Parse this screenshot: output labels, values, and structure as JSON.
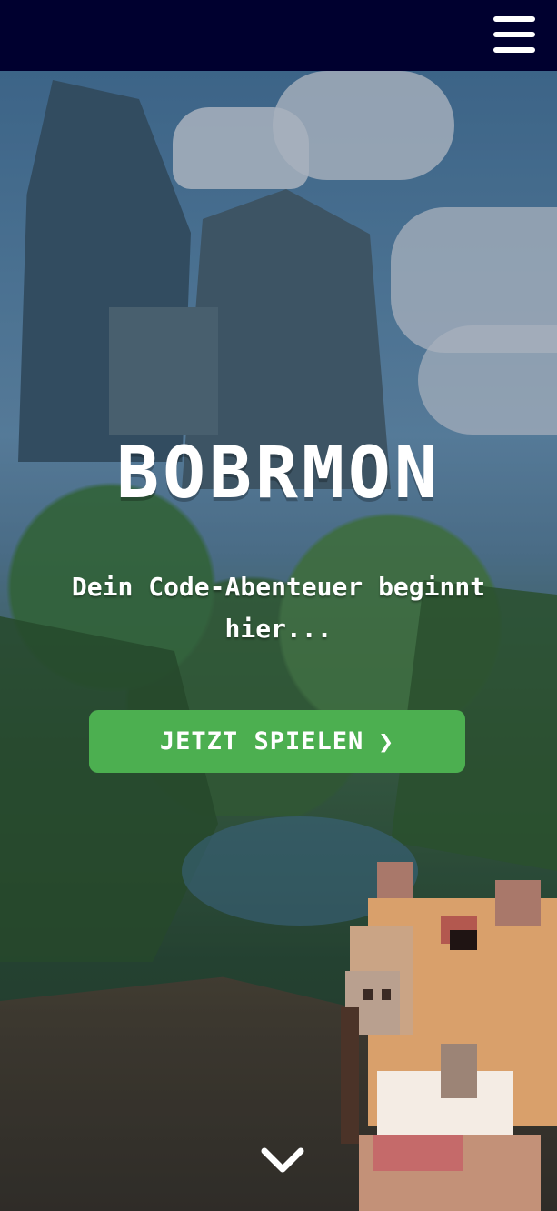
{
  "header": {
    "menu_icon": "hamburger-menu-icon"
  },
  "hero": {
    "title": "BOBRMON",
    "subtitle": "Dein Code-Abenteuer beginnt hier...",
    "cta_label": "JETZT SPIELEN",
    "cta_icon": "chevron-right-icon",
    "scroll_icon": "chevron-down-icon"
  },
  "colors": {
    "header_bg": "#00002f",
    "cta_bg": "#4caf50",
    "text": "#ffffff"
  }
}
